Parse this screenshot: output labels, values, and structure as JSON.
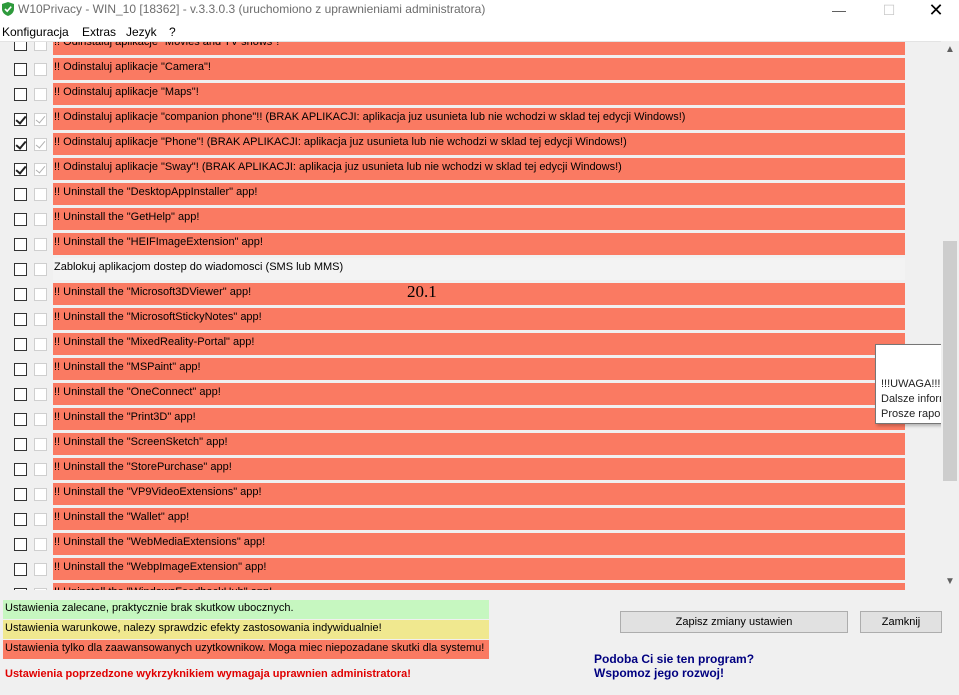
{
  "window": {
    "title": "W10Privacy - WIN_10 [18362]  - v.3.3.0.3 (uruchomiono z uprawnieniami administratora)",
    "minimize_glyph": "—",
    "maximize_glyph": "☐",
    "close_glyph": "✕"
  },
  "menu": {
    "items": [
      {
        "label": "Konfiguracja"
      },
      {
        "label": "Extras"
      },
      {
        "label": "Jezyk"
      },
      {
        "label": "?"
      }
    ]
  },
  "rows": [
    {
      "label": "!! Odinstaluj aplikacje \"Movies and TV shows\"!",
      "checked": false,
      "color": "red"
    },
    {
      "label": "!! Odinstaluj aplikacje \"Camera\"!",
      "checked": false,
      "color": "red"
    },
    {
      "label": "!! Odinstaluj aplikacje \"Maps\"!",
      "checked": false,
      "color": "red"
    },
    {
      "label": "!! Odinstaluj aplikacje \"companion phone\"!! (BRAK APLIKACJI: aplikacja juz usunieta lub nie wchodzi w sklad tej edycji Windows!)",
      "checked": true,
      "color": "red"
    },
    {
      "label": "!! Odinstaluj aplikacje \"Phone\"! (BRAK APLIKACJI: aplikacja juz usunieta lub nie wchodzi w sklad tej edycji Windows!)",
      "checked": true,
      "color": "red"
    },
    {
      "label": "!! Odinstaluj aplikacje \"Sway\"! (BRAK APLIKACJI: aplikacja juz usunieta lub nie wchodzi w sklad tej edycji Windows!)",
      "checked": true,
      "color": "red"
    },
    {
      "label": "!! Uninstall the \"DesktopAppInstaller\" app!",
      "checked": false,
      "color": "red"
    },
    {
      "label": "!! Uninstall the \"GetHelp\" app!",
      "checked": false,
      "color": "red"
    },
    {
      "label": "!! Uninstall the \"HEIFImageExtension\" app!",
      "checked": false,
      "color": "red"
    },
    {
      "label": "Zablokuj aplikacjom dostep do wiadomosci (SMS lub MMS)",
      "checked": false,
      "color": "light"
    },
    {
      "label": "!! Uninstall the \"Microsoft3DViewer\" app!",
      "checked": false,
      "color": "red"
    },
    {
      "label": "!! Uninstall the \"MicrosoftStickyNotes\" app!",
      "checked": false,
      "color": "red"
    },
    {
      "label": "!! Uninstall the \"MixedReality-Portal\" app!",
      "checked": false,
      "color": "red"
    },
    {
      "label": "!! Uninstall the \"MSPaint\" app!",
      "checked": false,
      "color": "red"
    },
    {
      "label": "!! Uninstall the \"OneConnect\" app!",
      "checked": false,
      "color": "red"
    },
    {
      "label": "!! Uninstall the \"Print3D\" app!",
      "checked": false,
      "color": "red"
    },
    {
      "label": "!! Uninstall the \"ScreenSketch\" app!",
      "checked": false,
      "color": "red"
    },
    {
      "label": "!! Uninstall the \"StorePurchase\" app!",
      "checked": false,
      "color": "red"
    },
    {
      "label": "!! Uninstall the \"VP9VideoExtensions\" app!",
      "checked": false,
      "color": "red"
    },
    {
      "label": "!! Uninstall the \"Wallet\" app!",
      "checked": false,
      "color": "red"
    },
    {
      "label": "!! Uninstall the \"WebMediaExtensions\" app!",
      "checked": false,
      "color": "red"
    },
    {
      "label": "!! Uninstall the \"WebpImageExtension\" app!",
      "checked": false,
      "color": "red"
    },
    {
      "label": "!! Uninstall the \"WindowsFeedbackHub\" app!",
      "checked": false,
      "color": "red"
    }
  ],
  "overlay_text": "20.1",
  "tooltip": {
    "lines": [
      "!!!UWAGA!!! Od",
      "Dalsze informa",
      "Prosze raportow"
    ]
  },
  "scrollbar": {
    "up_glyph": "▲",
    "down_glyph": "▼"
  },
  "legend": {
    "green": "Ustawienia zalecane, praktycznie brak skutkow ubocznych.",
    "yellow": "Ustawienia warunkowe, nalezy sprawdzic efekty zastosowania indywidualnie!",
    "red": "Ustawienia tylko dla zaawansowanych uzytkownikow. Moga miec niepozadane skutki dla systemu!"
  },
  "warning": "Ustawienia poprzedzone wykrzyknikiem wymagaja uprawnien administratora!",
  "buttons": {
    "save": "Zapisz zmiany ustawien",
    "close": "Zamknij"
  },
  "promo": {
    "line1": "Podoba Ci sie ten program?",
    "line2": "Wspomoz jego rozwoj!"
  },
  "colors": {
    "row_red": "#fa7a62",
    "legend_green": "#c6f7c0",
    "legend_yellow": "#f0e88f",
    "warning_red": "#e00000",
    "promo_blue": "#000080"
  }
}
